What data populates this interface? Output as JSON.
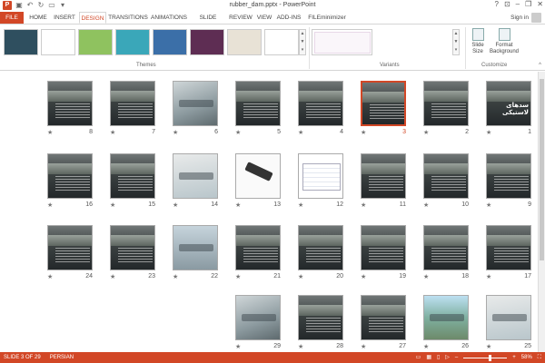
{
  "window": {
    "title": "rubber_dam.pptx - PowerPoint"
  },
  "tabs": [
    "FILE",
    "HOME",
    "INSERT",
    "DESIGN",
    "TRANSITIONS",
    "ANIMATIONS",
    "SLIDE SHOW",
    "REVIEW",
    "VIEW",
    "ADD-INS",
    "FILEminimizer"
  ],
  "account": {
    "signin": "Sign in"
  },
  "ribbon": {
    "themes_label": "Themes",
    "variants_label": "Variants",
    "customize_label": "Customize",
    "slide_size_label": "Slide Size",
    "format_bg_label": "Format Background",
    "theme_colors": [
      "#2f4f5f",
      "#ffffff",
      "#8fc25f",
      "#3aa7b9",
      "#3b6fa8",
      "#5e2d53",
      "#e8e2d6",
      "#ffffff"
    ]
  },
  "slides": [
    {
      "n": "1",
      "kind": "dark-title",
      "title": "سدهای لاستیکی"
    },
    {
      "n": "2",
      "kind": "dark"
    },
    {
      "n": "3",
      "kind": "dark",
      "selected": true
    },
    {
      "n": "4",
      "kind": "dark"
    },
    {
      "n": "5",
      "kind": "dark"
    },
    {
      "n": "6",
      "kind": "photo-a"
    },
    {
      "n": "7",
      "kind": "dark"
    },
    {
      "n": "8",
      "kind": "dark"
    },
    {
      "n": "9",
      "kind": "dark"
    },
    {
      "n": "10",
      "kind": "dark"
    },
    {
      "n": "11",
      "kind": "dark"
    },
    {
      "n": "12",
      "kind": "table"
    },
    {
      "n": "13",
      "kind": "white"
    },
    {
      "n": "14",
      "kind": "photo-b"
    },
    {
      "n": "15",
      "kind": "dark"
    },
    {
      "n": "16",
      "kind": "dark"
    },
    {
      "n": "17",
      "kind": "dark"
    },
    {
      "n": "18",
      "kind": "dark"
    },
    {
      "n": "19",
      "kind": "dark"
    },
    {
      "n": "20",
      "kind": "dark"
    },
    {
      "n": "21",
      "kind": "dark"
    },
    {
      "n": "22",
      "kind": "photo-d"
    },
    {
      "n": "23",
      "kind": "dark"
    },
    {
      "n": "24",
      "kind": "dark"
    },
    {
      "n": "25",
      "kind": "photo-b"
    },
    {
      "n": "26",
      "kind": "photo-c"
    },
    {
      "n": "27",
      "kind": "dark"
    },
    {
      "n": "28",
      "kind": "dark"
    },
    {
      "n": "29",
      "kind": "photo-a"
    }
  ],
  "status": {
    "slide_of": "SLIDE 3 OF 29",
    "language": "PERSIAN",
    "zoom": "58%"
  }
}
